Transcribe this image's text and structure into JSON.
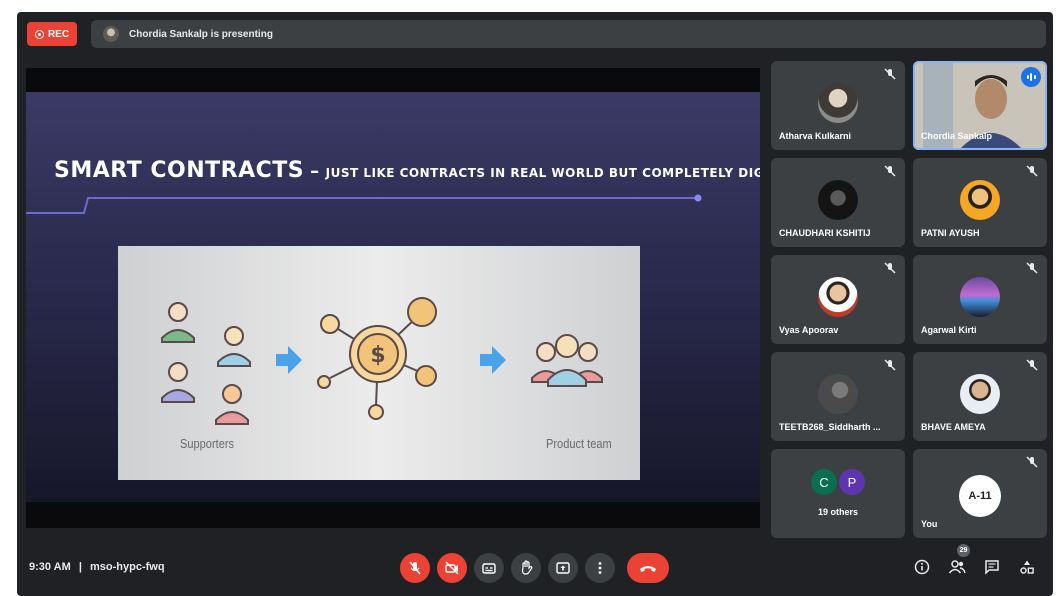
{
  "recording": {
    "label": "REC"
  },
  "presenting_bar": {
    "text": "Chordia Sankalp is presenting"
  },
  "slide": {
    "title_main": "SMART CONTRACTS",
    "title_dash": "–",
    "title_sub": "JUST LIKE CONTRACTS IN REAL WORLD BUT COMPLETELY DIGITAL",
    "label_left": "Supporters",
    "label_right": "Product team"
  },
  "participants": [
    {
      "name": "Atharva Kulkarni",
      "muted": true
    },
    {
      "name": "Chordia Sankalp",
      "muted": false,
      "speaking": true
    },
    {
      "name": "CHAUDHARI KSHITIJ",
      "muted": true
    },
    {
      "name": "PATNI AYUSH",
      "muted": true
    },
    {
      "name": "Vyas Apoorav",
      "muted": true
    },
    {
      "name": "Agarwal Kirti",
      "muted": true
    },
    {
      "name": "TEETB268_Siddharth ...",
      "muted": true
    },
    {
      "name": "BHAVE AMEYA",
      "muted": true
    }
  ],
  "others_tile": {
    "initials": [
      "C",
      "P"
    ],
    "colors": [
      "#0b6e4f",
      "#5e35b1"
    ],
    "label": "19 others"
  },
  "you_tile": {
    "avatar_text": "A-11",
    "name": "You",
    "muted": true
  },
  "meeting": {
    "time": "9:30 AM",
    "separator": "|",
    "code": "mso-hypc-fwq"
  },
  "people_count": "29",
  "controls": [
    {
      "name": "mic-off",
      "color": "#ea4335"
    },
    {
      "name": "camera-off",
      "color": "#ea4335"
    },
    {
      "name": "captions",
      "color": "#3c4043"
    },
    {
      "name": "raise-hand",
      "color": "#3c4043"
    },
    {
      "name": "present-screen",
      "color": "#3c4043"
    },
    {
      "name": "more-options",
      "color": "#3c4043"
    },
    {
      "name": "end-call",
      "color": "#ea4335"
    }
  ],
  "right_controls": [
    "info-icon",
    "people-icon",
    "chat-icon",
    "activities-icon"
  ],
  "theme": {
    "background": "#202124",
    "tile": "#3c4043",
    "accent": "#8ab4f8",
    "danger": "#ea4335"
  }
}
